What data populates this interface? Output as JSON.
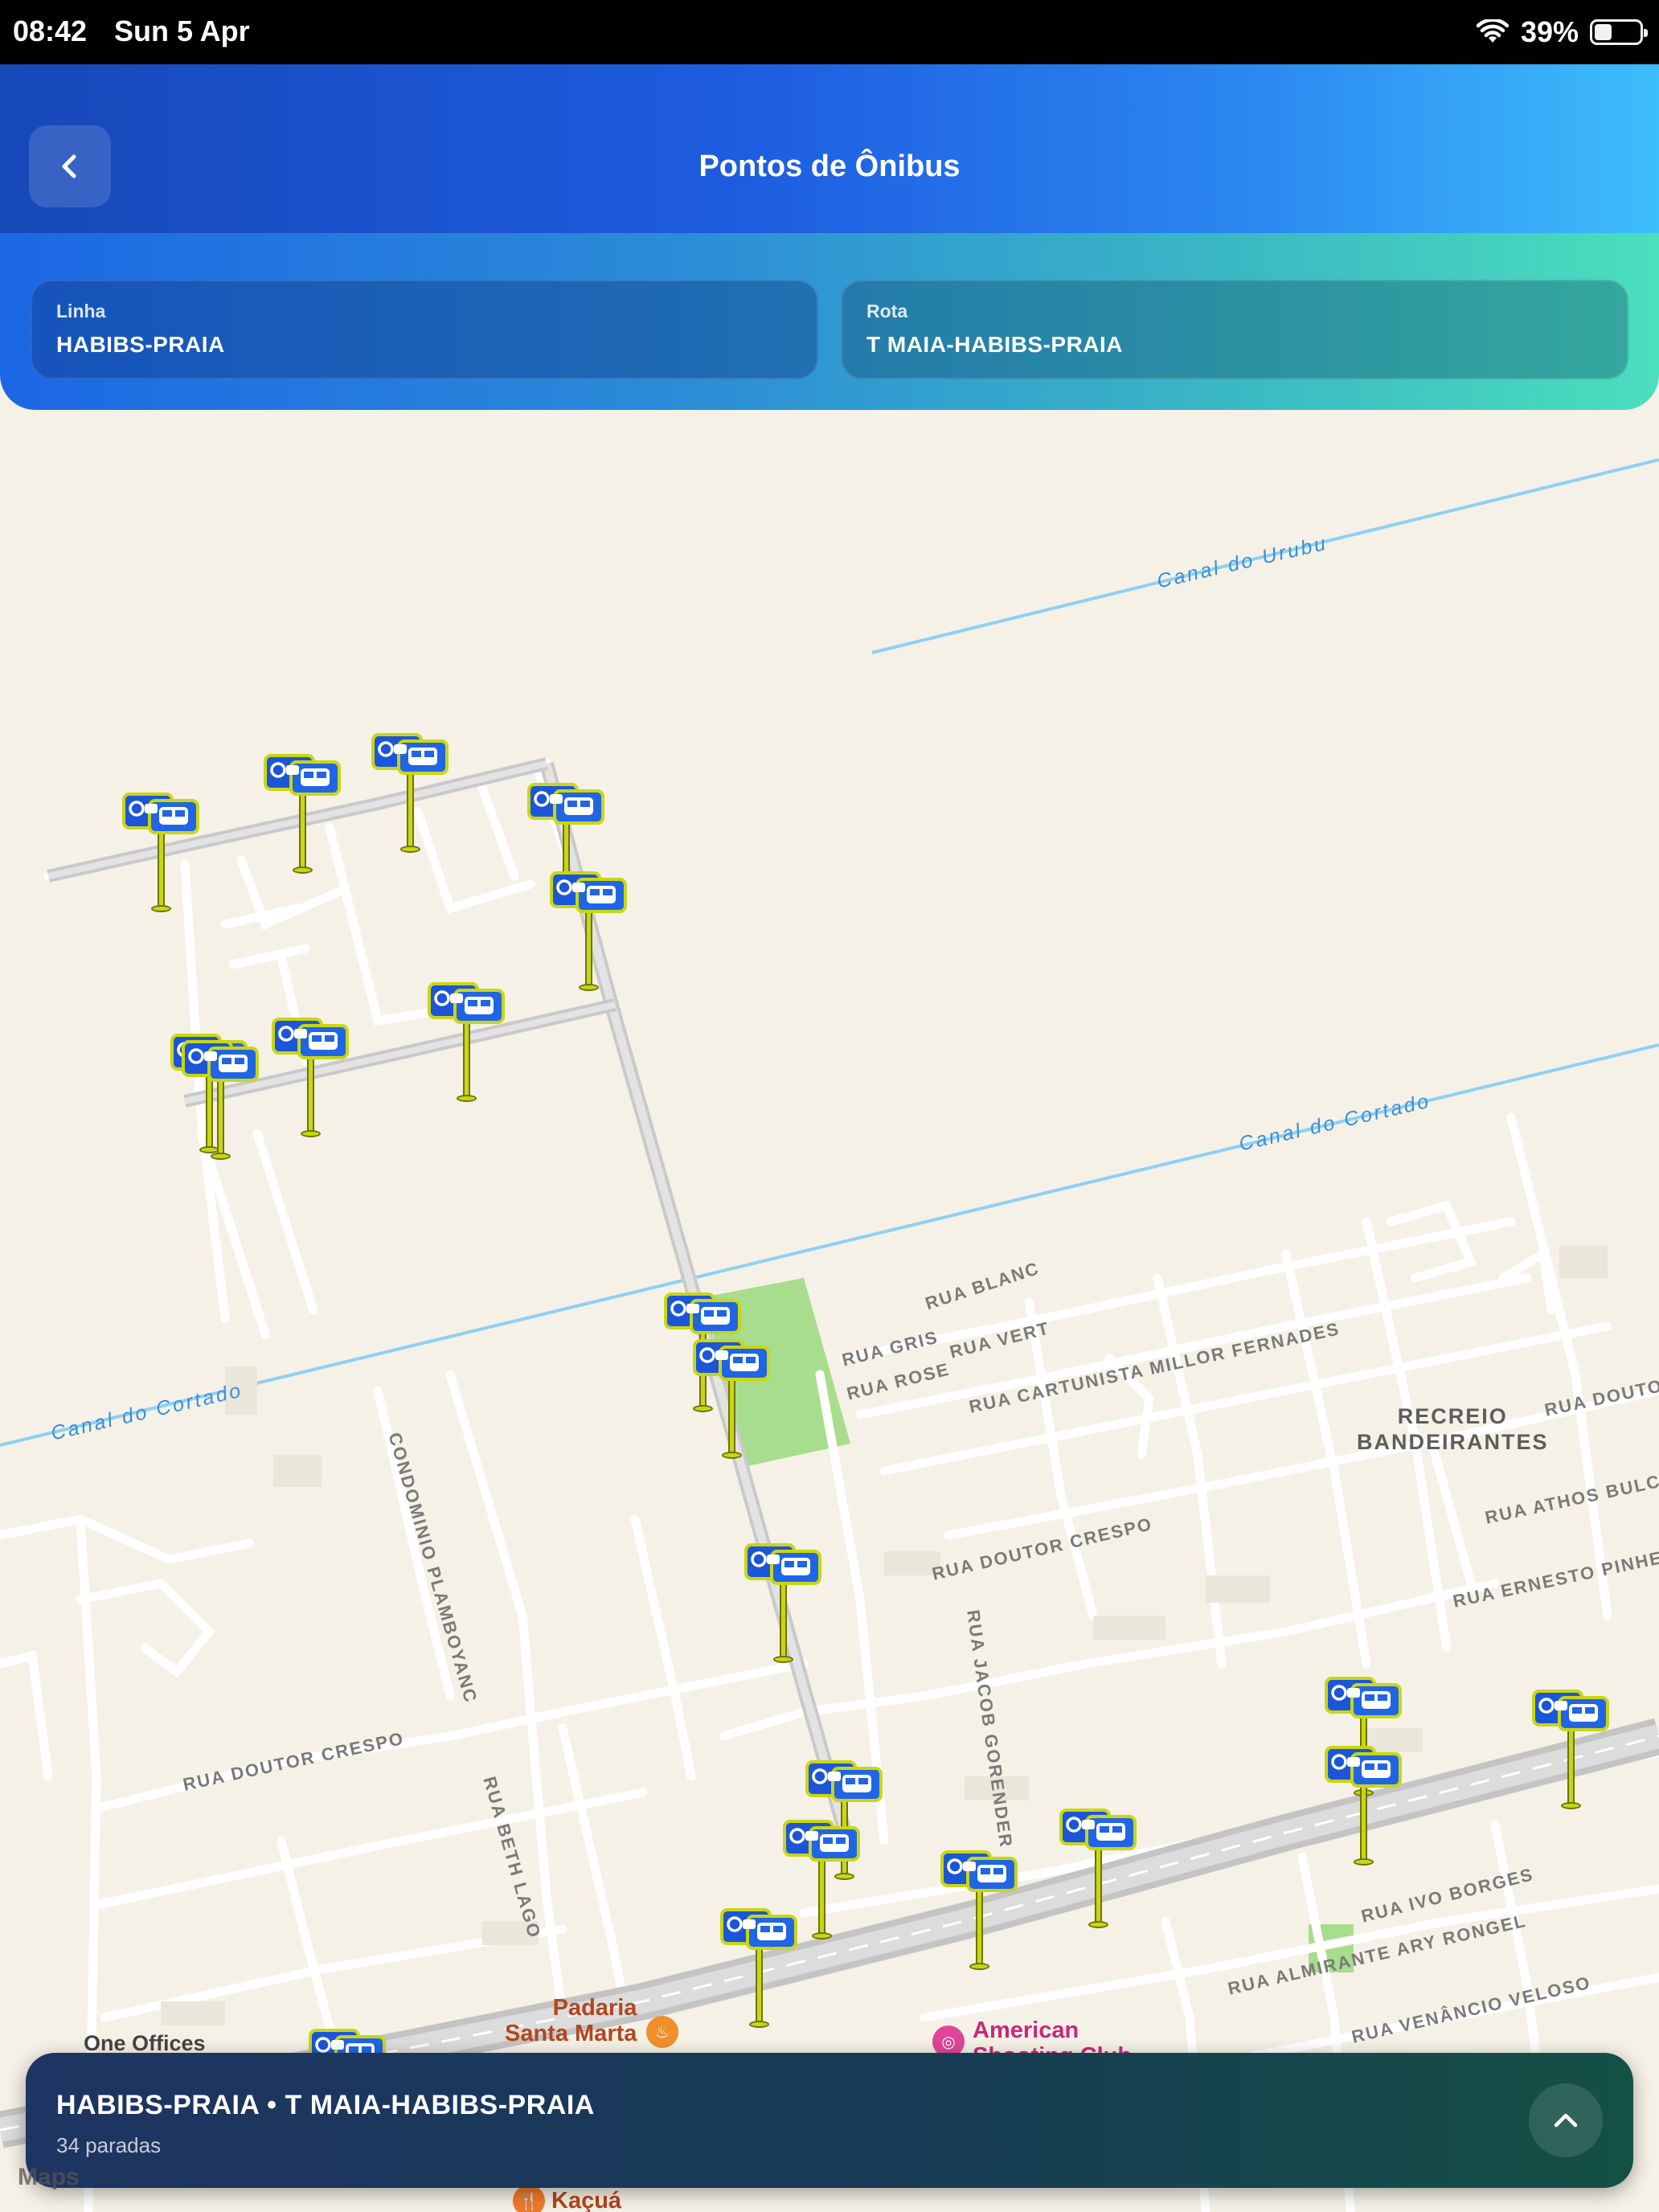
{
  "status_bar": {
    "time": "08:42",
    "date": "Sun 5 Apr",
    "battery_percent": "39%",
    "battery_level": 0.39
  },
  "header": {
    "title": "Pontos de Ônibus",
    "back_icon": "chevron-left-icon"
  },
  "selectors": {
    "line": {
      "label": "Linha",
      "value": "HABIBS-PRAIA"
    },
    "route": {
      "label": "Rota",
      "value": "T MAIA-HABIBS-PRAIA"
    }
  },
  "map": {
    "canals": [
      "Canal do Urubu",
      "Canal do Cortado",
      "Canal do Cortado"
    ],
    "streets": [
      "RUA BLANC",
      "RUA GRIS",
      "RUA ROSE",
      "RUA VERT",
      "RUA CARTUNISTA MILLOR FERNADES",
      "RUA DOUTOR",
      "RUA ATHOS BULCÃO",
      "RUA ERNESTO PINHEIRO",
      "RUA DOUTOR CRESPO",
      "RUA DOUTOR CRESPO",
      "CONDOMINIO PLAMBOYANC",
      "RUA JACOB GORENDER",
      "RUA BETH LAGO",
      "RUA IVO BORGES",
      "RUA ALMIRANTE ARY RONGEL",
      "RUA VENÂNCIO VELOSO"
    ],
    "district": "RECREIO\nBANDEIRANTES",
    "pois": [
      {
        "name": "Padaria\nSanta Marta",
        "color": "#b3461e",
        "icon": "bakery-icon",
        "dot_color": "#f0902b"
      },
      {
        "name": "American\nShooting Club",
        "color": "#c8287a",
        "icon": "target-icon",
        "dot_color": "#e0459a"
      },
      {
        "name": "Kaçuá",
        "color": "#b3461e",
        "icon": "restaurant-icon",
        "dot_color": "#f07b2b"
      },
      {
        "name": "One Offices\nRecreio (Vendas\nno Salão...",
        "color": "#444444",
        "icon": "building-icon",
        "dot_color": "#5a6b87"
      }
    ],
    "attribution": "Maps",
    "stop_marker_icon": "bus-stop-icon",
    "stop_count": 23
  },
  "bottom_sheet": {
    "title": "HABIBS-PRAIA • T MAIA-HABIBS-PRAIA",
    "subtitle": "34 paradas",
    "expand_icon": "chevron-up-icon"
  }
}
